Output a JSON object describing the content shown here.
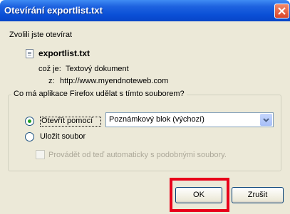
{
  "window": {
    "title": "Otevírání exportlist.txt"
  },
  "dialog": {
    "intro": "Zvolili jste otevírat",
    "filename": "exportlist.txt",
    "type_label": "což je:",
    "type_value": "Textový dokument",
    "source_label": "z:",
    "source_value": "http://www.myendnoteweb.com",
    "group_legend": "Co má aplikace Firefox udělat s tímto souborem?",
    "open_with_label": "Otevřít pomocí",
    "open_with_value": "Poznámkový blok (výchozí)",
    "save_label": "Uložit soubor",
    "auto_label": "Provádět od teď automaticky s podobnými soubory."
  },
  "buttons": {
    "ok": "OK",
    "cancel": "Zrušit"
  },
  "colors": {
    "titlebar": "#0a4fd6",
    "highlight_box": "#e8001a"
  }
}
